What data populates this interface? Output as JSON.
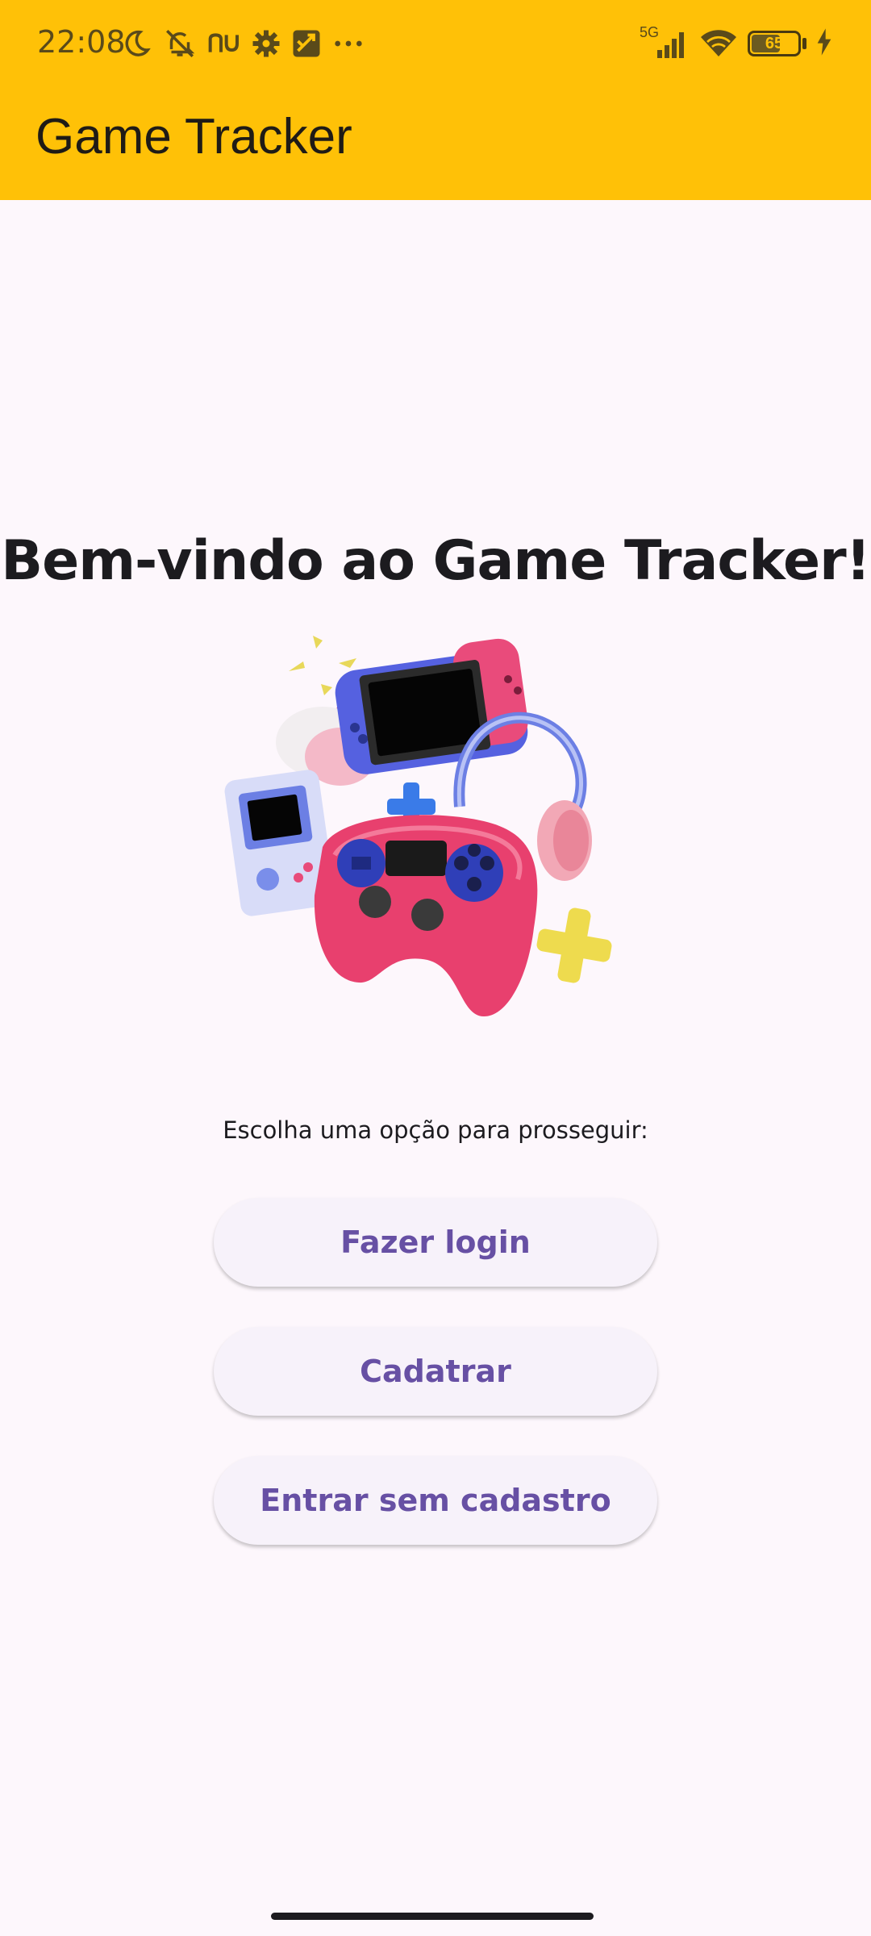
{
  "status_bar": {
    "time": "22:08",
    "network": "5G",
    "battery_percent": "65",
    "battery_level": 0.65,
    "icons_left": [
      "moon-icon",
      "bell-off-icon",
      "nu-icon",
      "gear-icon",
      "app-icon",
      "more-icon"
    ],
    "icons_right": [
      "signal-icon",
      "wifi-icon",
      "battery-icon",
      "charging-icon"
    ]
  },
  "app_bar": {
    "title": "Game Tracker",
    "color": "#FFC107"
  },
  "main": {
    "welcome_title": "Bem-vindo ao Game Tracker!",
    "illustration": "game-controllers-illustration",
    "prompt": "Escolha uma opção para prosseguir:",
    "buttons": {
      "login": "Fazer login",
      "signup": "Cadatrar",
      "guest": "Entrar sem cadastro"
    },
    "accent_color": "#6750A4",
    "background_color": "#FDF7FC"
  }
}
